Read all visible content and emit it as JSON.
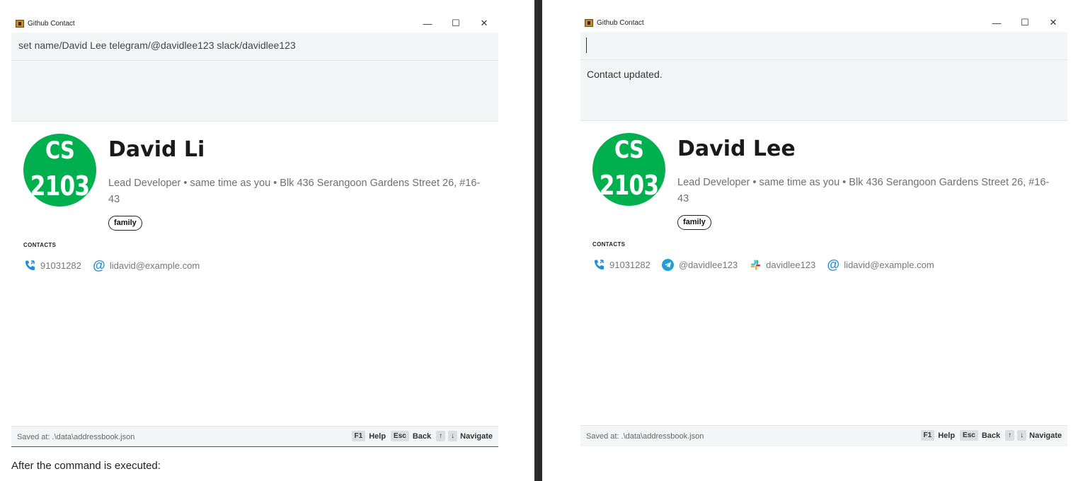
{
  "colors": {
    "accent_green": "#00b04f",
    "telegram_blue": "#229ed9",
    "phone_blue": "#1f8fd0",
    "divider": "#2b2b2b"
  },
  "before": {
    "window_title": "Github Contact",
    "command_text": "set name/David Lee telegram/@davidlee123 slack/davidlee123",
    "result_text": "",
    "avatar": {
      "line1": "CS",
      "line2": "2103"
    },
    "name": "David Li",
    "meta": "Lead Developer • same time as you • Blk 436 Serangoon Gardens Street 26, #16-43",
    "tag": "family",
    "contacts_label": "CONTACTS",
    "phone": "91031282",
    "email": "lidavid@example.com",
    "saved_text": "Saved at: .\\data\\addressbook.json"
  },
  "after": {
    "window_title": "Github Contact",
    "command_text": "",
    "result_text": "Contact updated.",
    "avatar": {
      "line1": "CS",
      "line2": "2103"
    },
    "name": "David Lee",
    "meta": "Lead Developer • same time as you • Blk 436 Serangoon Gardens Street 26, #16-43",
    "tag": "family",
    "contacts_label": "CONTACTS",
    "phone": "91031282",
    "telegram": "@davidlee123",
    "slack": "davidlee123",
    "email": "lidavid@example.com",
    "saved_text": "Saved at: .\\data\\addressbook.json"
  },
  "window_controls": {
    "minimize": "—",
    "maximize": "☐",
    "close": "✕"
  },
  "shortcuts": [
    {
      "key": "F1",
      "label": "Help"
    },
    {
      "key": "Esc",
      "label": "Back"
    },
    {
      "key": "↑",
      "label": ""
    },
    {
      "key": "↓",
      "label": "Navigate"
    }
  ],
  "caption": "After the command is executed:",
  "icons": [
    "app-icon",
    "phone-icon",
    "email-icon",
    "telegram-icon",
    "slack-icon",
    "minimize-icon",
    "maximize-icon",
    "close-icon"
  ]
}
